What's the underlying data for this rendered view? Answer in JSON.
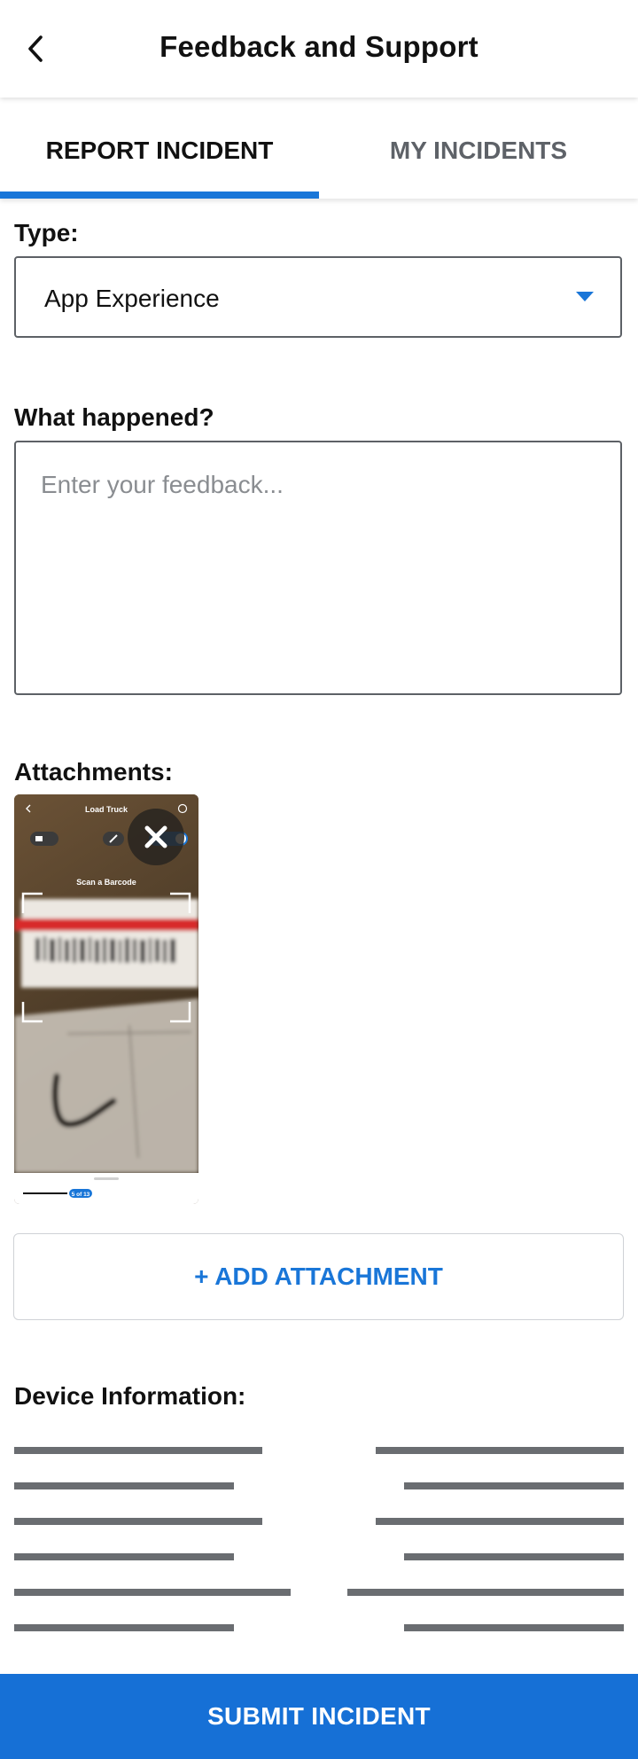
{
  "header": {
    "title": "Feedback and Support",
    "back_icon": "chevron-left-icon"
  },
  "tabs": [
    {
      "label": "REPORT INCIDENT",
      "active": true
    },
    {
      "label": "MY INCIDENTS",
      "active": false
    }
  ],
  "form": {
    "type_label": "Type:",
    "type_value": "App Experience",
    "what_label": "What happened?",
    "what_placeholder": "Enter your feedback...",
    "attachments_label": "Attachments:",
    "attachment": {
      "screen_title": "Load Truck",
      "scan_label": "Scan a Barcode",
      "page_badge": "5 of 13",
      "remove_icon": "close-icon"
    },
    "add_attachment_label": "+ ADD ATTACHMENT",
    "device_info_label": "Device Information:"
  },
  "submit_label": "SUBMIT INCIDENT",
  "colors": {
    "accent": "#1976d8",
    "submit_bg": "#1670d6",
    "redaction": "#6a6d71"
  }
}
